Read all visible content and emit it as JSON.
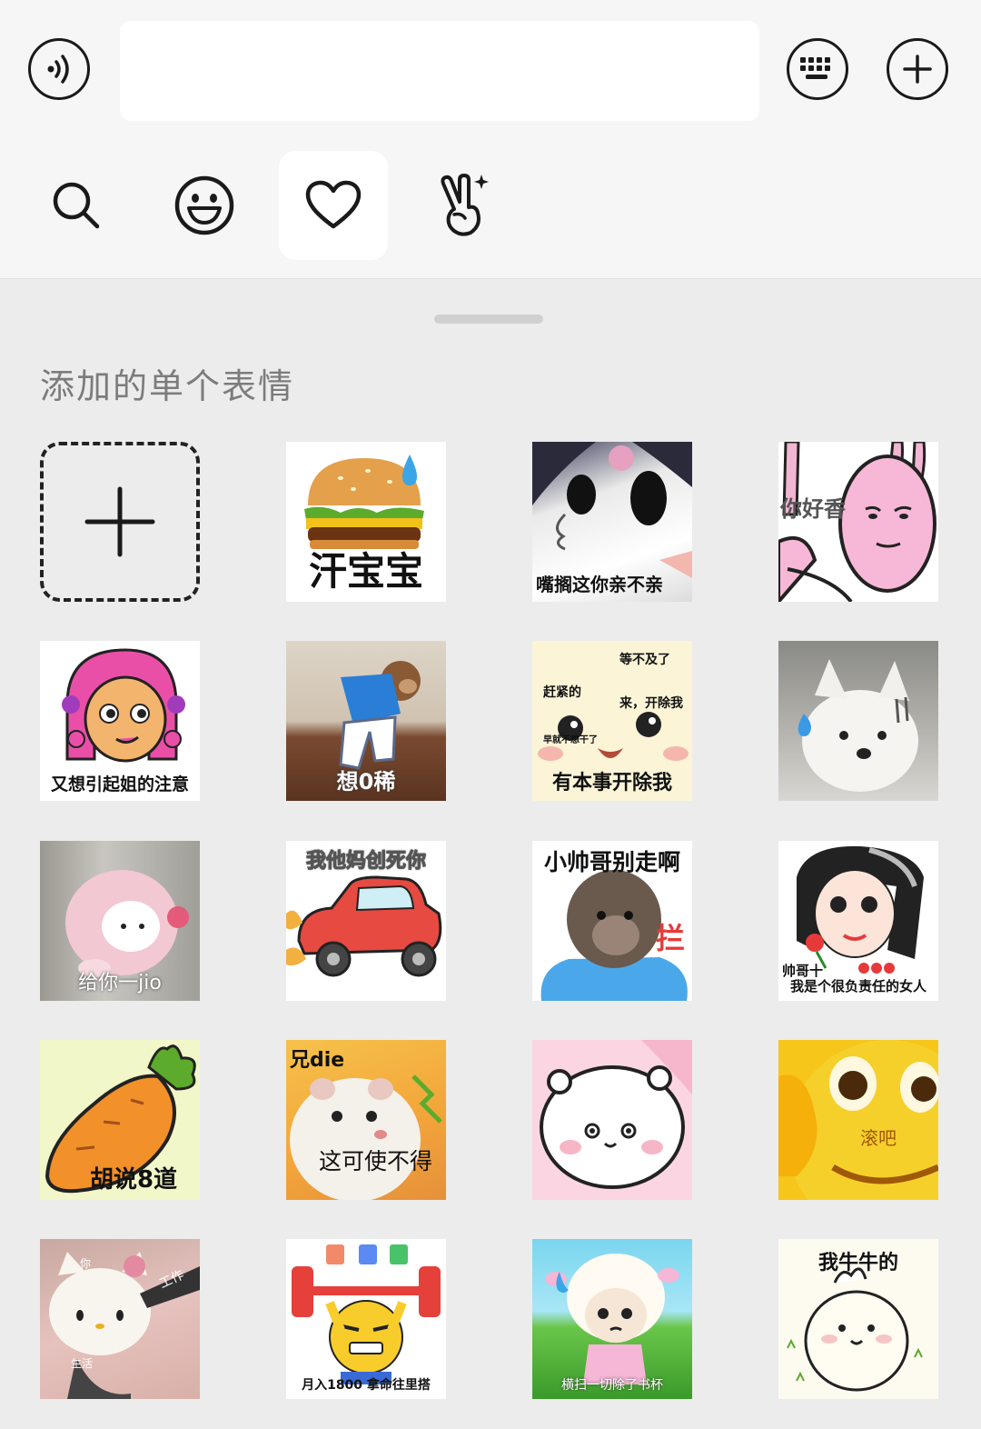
{
  "input": {
    "value": ""
  },
  "section": {
    "title": "添加的单个表情"
  },
  "stickers": {
    "s1": {
      "caption": "汗宝宝"
    },
    "s2": {
      "caption": "嘴搁这你亲不亲"
    },
    "s3": {
      "caption": "你好香"
    },
    "s4": {
      "caption": "又想引起姐的注意"
    },
    "s5": {
      "caption": "想0稀"
    },
    "s6": {
      "caption1": "等不及了",
      "caption2": "赶紧的",
      "caption3": "来，开除我",
      "caption4": "早就不想干了",
      "caption5": "有本事开除我"
    },
    "s8": {
      "caption": "给你一jio"
    },
    "s9": {
      "caption": "我他妈创死你"
    },
    "s10": {
      "caption1": "小帅哥别走啊",
      "caption2": "拦"
    },
    "s11": {
      "caption1": "帅哥十",
      "caption2": "我是个很负责任的女人"
    },
    "s12": {
      "caption": "胡说8道"
    },
    "s13": {
      "caption1": "兄die",
      "caption2": "这可使不得"
    },
    "s15": {
      "caption": "滚吧"
    },
    "s16": {
      "caption1": "你",
      "caption2": "工作",
      "caption3": "生活"
    },
    "s17": {
      "caption": "月入1800 拿命往里搭",
      "icons": [
        "P",
        "W",
        "X"
      ]
    },
    "s18": {
      "caption": "横扫一切除了书杯"
    },
    "s19": {
      "caption": "我牛牛的"
    }
  },
  "colors": {
    "accent": "#1a1a1a",
    "panel": "#ececec",
    "topbar": "#f6f6f6"
  }
}
